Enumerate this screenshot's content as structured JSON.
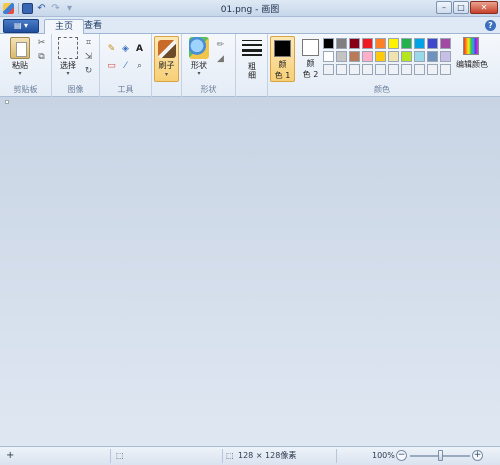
{
  "window": {
    "title": "01.png - 画图",
    "min": "–",
    "max": "□",
    "close": "✕"
  },
  "quick_access": {
    "undo": "↶",
    "redo": "↷",
    "customize": "▾"
  },
  "tabs": {
    "menu_button": "▤ ▾",
    "home": "主页",
    "view": "查看",
    "help": "?"
  },
  "ribbon": {
    "clipboard": {
      "label": "剪贴板",
      "paste": "粘贴",
      "cut_glyph": "✂",
      "copy_glyph": "⧉"
    },
    "image": {
      "label": "图像",
      "select": "选择",
      "crop_glyph": "⌗",
      "resize_glyph": "⇲",
      "rotate_glyph": "↻"
    },
    "tools": {
      "label": "工具",
      "pencil": "✎",
      "fill": "◈",
      "text": "A",
      "eraser": "▭",
      "picker": "⁄",
      "magnifier": "⌕"
    },
    "brush": {
      "label": "刷子"
    },
    "shapes": {
      "label": "形状",
      "group_label": "形状",
      "outline_glyph": "✏",
      "fill_glyph": "◢"
    },
    "size": {
      "label_line1": "粗",
      "label_line2": "细"
    },
    "colors": {
      "label": "颜色",
      "color1_line1": "颜",
      "color1_line2": "色 1",
      "color2_line1": "颜",
      "color2_line2": "色 2",
      "edit": "编辑颜色",
      "color1_value": "#000000",
      "color2_value": "#ffffff",
      "palette": [
        "#000000",
        "#7f7f7f",
        "#880015",
        "#ed1c24",
        "#ff7f27",
        "#fff200",
        "#22b14c",
        "#00a2e8",
        "#3f48cc",
        "#a349a4",
        "#ffffff",
        "#c3c3c3",
        "#b97a57",
        "#ffaec9",
        "#ffc90e",
        "#efe4b0",
        "#b5e61d",
        "#99d9ea",
        "#7092be",
        "#c8bfe7",
        "#eef2f7",
        "#eef2f7",
        "#eef2f7",
        "#eef2f7",
        "#eef2f7",
        "#eef2f7",
        "#eef2f7",
        "#eef2f7",
        "#eef2f7",
        "#eef2f7"
      ]
    }
  },
  "status": {
    "cursor_glyph": "+",
    "selection_glyph": "⬚",
    "image_size": "128 × 128像素",
    "zoom": "100%",
    "zoom_out": "−",
    "zoom_in": "+",
    "zoom_fraction": 0.5
  }
}
